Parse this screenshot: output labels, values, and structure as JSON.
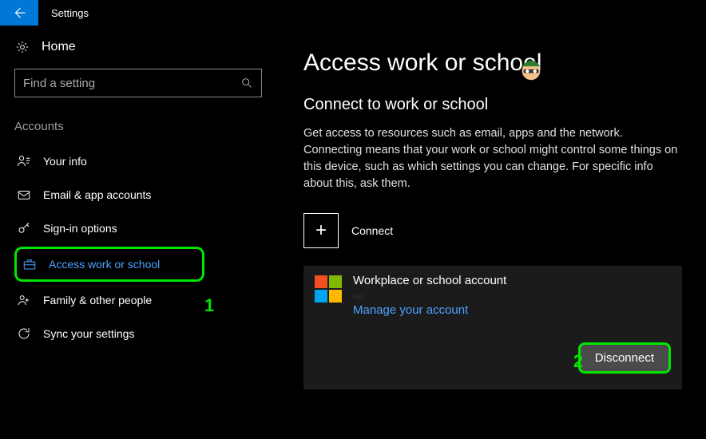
{
  "window": {
    "title": "Settings"
  },
  "sidebar": {
    "home": "Home",
    "search_placeholder": "Find a setting",
    "section": "Accounts",
    "items": [
      {
        "label": "Your info"
      },
      {
        "label": "Email & app accounts"
      },
      {
        "label": "Sign-in options"
      },
      {
        "label": "Access work or school",
        "active": true
      },
      {
        "label": "Family & other people"
      },
      {
        "label": "Sync your settings"
      }
    ]
  },
  "main": {
    "title": "Access work or school",
    "subtitle": "Connect to work or school",
    "description": "Get access to resources such as email, apps and the network. Connecting means that your work or school might control some things on this device, such as which settings you can change. For specific info about this, ask them.",
    "connect_label": "Connect",
    "account": {
      "title": "Workplace or school account",
      "sub_blurred": "—",
      "manage_link": "Manage your account",
      "disconnect": "Disconnect"
    }
  },
  "annotations": {
    "one": "1",
    "two": "2"
  }
}
